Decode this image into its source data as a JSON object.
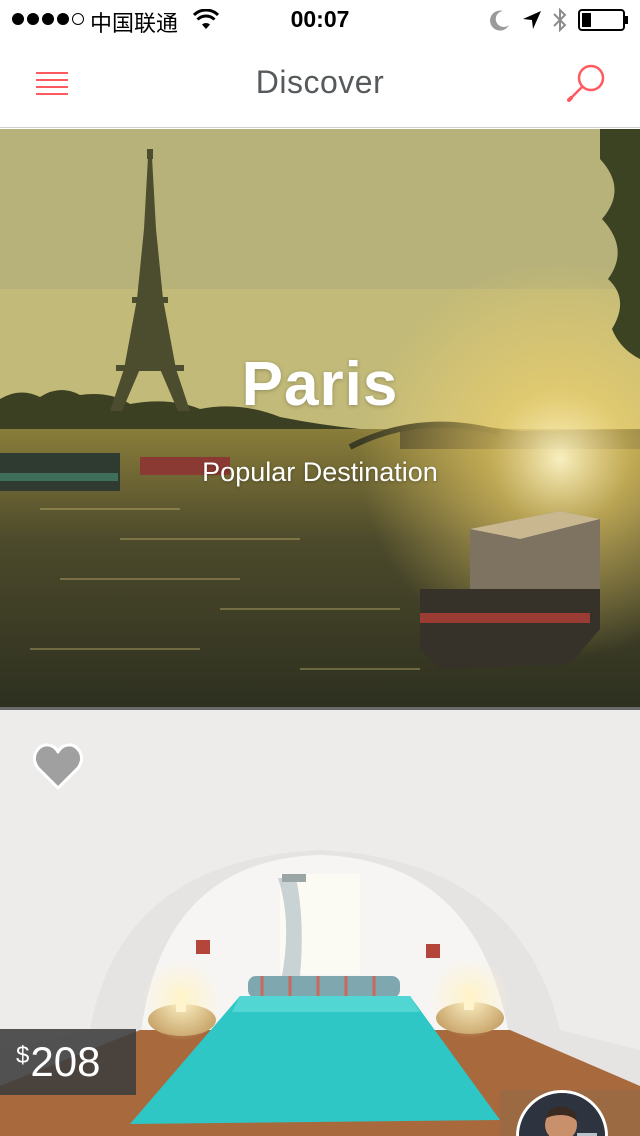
{
  "status_bar": {
    "signal_dots": [
      true,
      true,
      true,
      true,
      false
    ],
    "carrier": "中国联通",
    "time": "00:07",
    "icons": [
      "wifi-icon",
      "moon-icon",
      "location-arrow-icon",
      "bluetooth-icon",
      "battery-icon"
    ]
  },
  "nav": {
    "title": "Discover",
    "left_icon": "hamburger-menu-icon",
    "right_icon": "search-icon"
  },
  "hero": {
    "title": "Paris",
    "subtitle": "Popular Destination"
  },
  "listing": {
    "price_currency": "$",
    "price_amount": "208",
    "favorite_icon": "heart-icon",
    "favorited": false
  },
  "colors": {
    "accent": "#ff5a5f",
    "nav_title": "#565a5c",
    "price_badge": "#3c3c3c"
  }
}
